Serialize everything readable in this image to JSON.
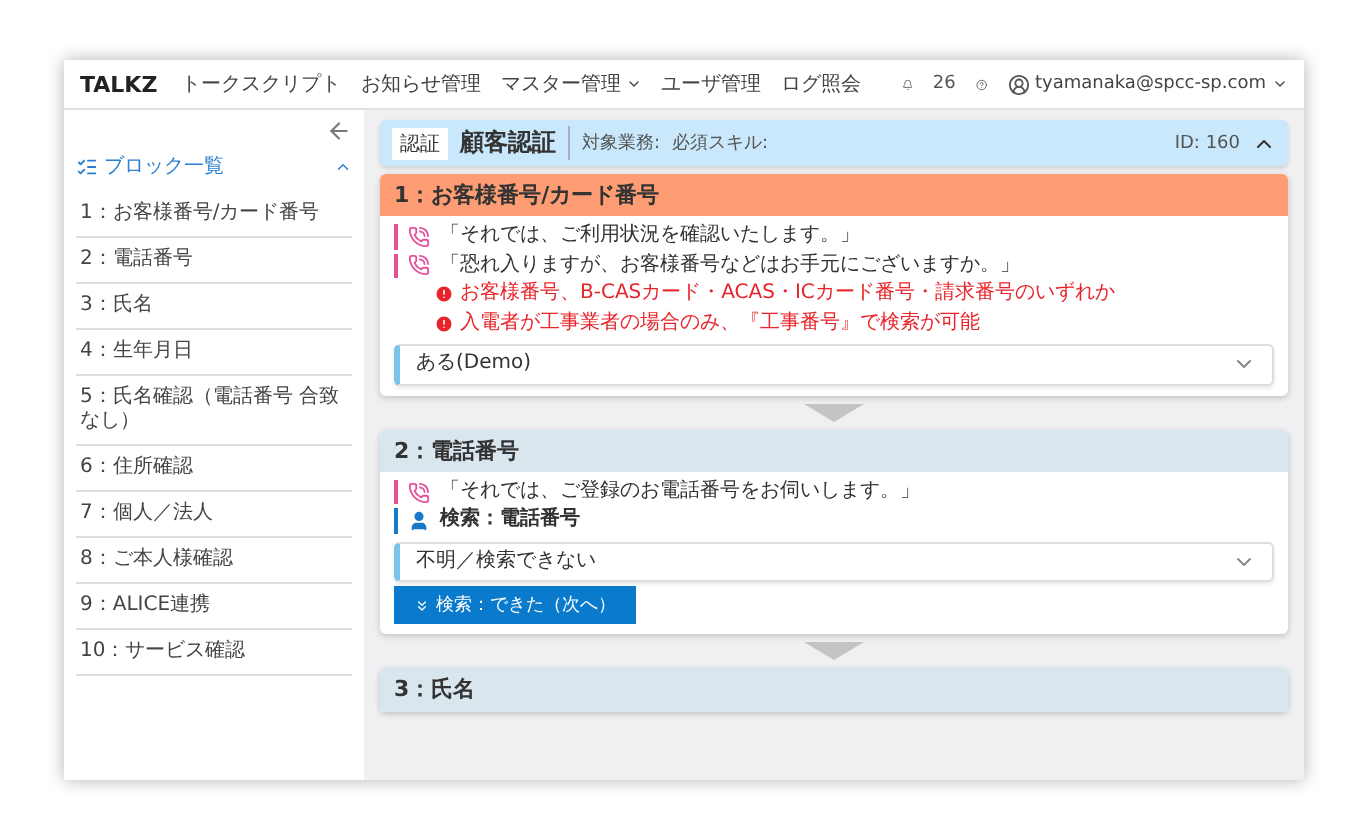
{
  "header": {
    "logo": "TALKZ",
    "nav": [
      {
        "label": "トークスクリプト",
        "dropdown": false
      },
      {
        "label": "お知らせ管理",
        "dropdown": false
      },
      {
        "label": "マスター管理",
        "dropdown": true
      },
      {
        "label": "ユーザ管理",
        "dropdown": false
      },
      {
        "label": "ログ照会",
        "dropdown": false
      }
    ],
    "notification_count": "26",
    "user": "tyamanaka@spcc-sp.com"
  },
  "sidebar": {
    "title": "ブロック一覧",
    "expanded": true,
    "items": [
      "1：お客様番号/カード番号",
      "2：電話番号",
      "3：氏名",
      "4：生年月日",
      "5：氏名確認（電話番号 合致なし）",
      "6：住所確認",
      "7：個人／法人",
      "8：ご本人様確認",
      "9：ALICE連携",
      "10：サービス確認"
    ]
  },
  "script_header": {
    "tag": "認証",
    "title": "顧客認証",
    "target_label": "対象業務:",
    "skill_label": "必須スキル:",
    "id": "ID: 160",
    "expanded": true
  },
  "blocks": [
    {
      "title": "1：お客様番号/カード番号",
      "active": true,
      "lines": [
        {
          "kind": "speech",
          "text": "「それでは、ご利用状況を確認いたします。」"
        },
        {
          "kind": "speech",
          "text": "「恐れ入りますが、お客様番号などはお手元にございますか。」"
        },
        {
          "kind": "note",
          "text": "お客様番号、B-CASカード・ACAS・ICカード番号・請求番号のいずれか"
        },
        {
          "kind": "note",
          "text": "入電者が工事業者の場合のみ、『工事番号』で検索が可能"
        }
      ],
      "select": "ある(Demo)"
    },
    {
      "title": "2：電話番号",
      "active": false,
      "lines": [
        {
          "kind": "speech",
          "text": "「それでは、ご登録のお電話番号をお伺いします。」"
        },
        {
          "kind": "action",
          "text": "検索：電話番号"
        }
      ],
      "select": "不明／検索できない",
      "button": "検索：できた（次へ）"
    },
    {
      "title": "3：氏名",
      "active": false
    }
  ]
}
